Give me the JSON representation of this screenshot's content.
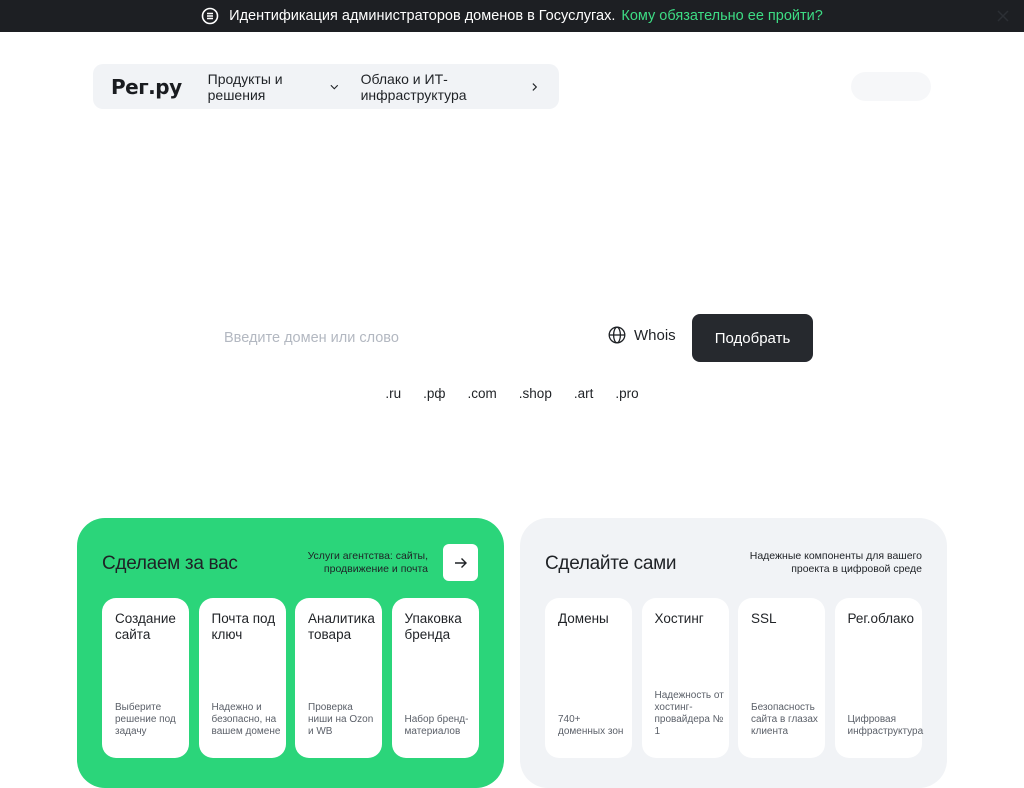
{
  "banner": {
    "text": "Идентификация администраторов доменов в Госуслугах.",
    "link": "Кому обязательно ее пройти?"
  },
  "header": {
    "logo": "Рег.ру",
    "nav": [
      "Продукты и решения",
      "Облако и ИТ-инфраструктура"
    ]
  },
  "search": {
    "placeholder": "Введите домен или слово",
    "whois": "Whois",
    "submit": "Подобрать"
  },
  "zones": [
    ".ru",
    ".рф",
    ".com",
    ".shop",
    ".art",
    ".pro"
  ],
  "agency": {
    "title": "Сделаем за вас",
    "desc": "Услуги агентства: сайты, продвижение и почта",
    "tiles": [
      {
        "title": "Создание сайта",
        "desc": "Выберите решение под задачу"
      },
      {
        "title": "Почта под ключ",
        "desc": "Надежно и безопасно, на вашем домене"
      },
      {
        "title": "Аналитика товара",
        "desc": "Проверка ниши на Ozon и WB"
      },
      {
        "title": "Упаковка бренда",
        "desc": "Набор бренд-материалов"
      }
    ]
  },
  "self": {
    "title": "Сделайте сами",
    "desc": "Надежные компоненты для вашего проекта в цифровой среде",
    "tiles": [
      {
        "title": "Домены",
        "desc": "740+ доменных зон"
      },
      {
        "title": "Хостинг",
        "desc": "Надежность от хостинг-провайдера № 1"
      },
      {
        "title": "SSL",
        "desc": "Безопасность сайта в глазах клиента"
      },
      {
        "title": "Рег.облако",
        "desc": "Цифровая инфраструктура"
      }
    ]
  },
  "colors": {
    "accent_green": "#2bd57a",
    "banner_bg": "#1d1f23",
    "link_green": "#3ddc84"
  }
}
